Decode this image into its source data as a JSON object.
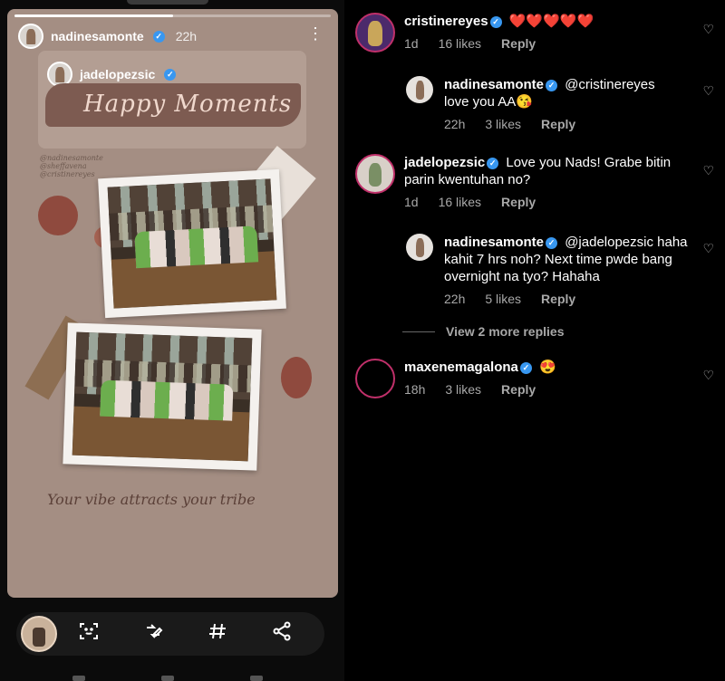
{
  "story": {
    "username": "nadinesamonte",
    "time_ago": "22h",
    "progress": 0.5,
    "repost_username": "jadelopezsic",
    "title_text": "Happy Moments",
    "tags": [
      "@nadinesamonte",
      "@sheffavena",
      "@cristinereyes"
    ],
    "tagline": "Your vibe attracts your tribe"
  },
  "bottom_bar": {
    "icons": [
      "face-scan-icon",
      "edit-icon",
      "hashtag-icon",
      "share-icon"
    ]
  },
  "comments": [
    {
      "username": "cristinereyes",
      "verified": true,
      "text": "❤️❤️❤️❤️❤️",
      "time": "1d",
      "likes": "16 likes",
      "reply_label": "Reply"
    },
    {
      "username": "nadinesamonte",
      "verified": true,
      "text": "@cristinereyes love you AA😘",
      "time": "22h",
      "likes": "3 likes",
      "reply_label": "Reply"
    },
    {
      "username": "jadelopezsic",
      "verified": true,
      "text": "Love you Nads! Grabe bitin parin kwentuhan no?",
      "time": "1d",
      "likes": "16 likes",
      "reply_label": "Reply"
    },
    {
      "username": "nadinesamonte",
      "verified": true,
      "text": "@jadelopezsic haha kahit 7 hrs noh? Next time pwde bang overnight na tyo? Hahaha",
      "time": "22h",
      "likes": "5 likes",
      "reply_label": "Reply"
    },
    {
      "username": "maxenemagalona",
      "verified": true,
      "text": "😍",
      "time": "18h",
      "likes": "3 likes",
      "reply_label": "Reply"
    }
  ],
  "view_more_replies": "View 2 more replies",
  "colors": {
    "verified": "#3897f0",
    "story_bg": "#a48e83",
    "ring": "#c0306a"
  }
}
